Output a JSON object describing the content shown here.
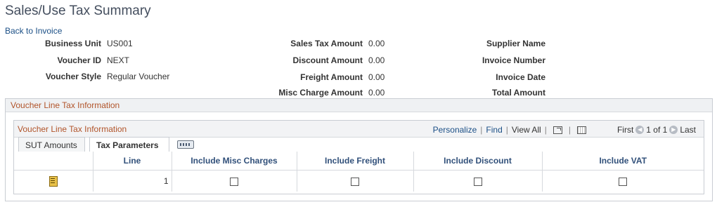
{
  "page_title": "Sales/Use Tax Summary",
  "back_link": "Back to Invoice",
  "fields": {
    "business_unit": {
      "label": "Business Unit",
      "value": "US001"
    },
    "voucher_id": {
      "label": "Voucher ID",
      "value": "NEXT"
    },
    "voucher_style": {
      "label": "Voucher Style",
      "value": "Regular Voucher"
    },
    "sales_tax_amount": {
      "label": "Sales Tax Amount",
      "value": "0.00"
    },
    "discount_amount": {
      "label": "Discount Amount",
      "value": "0.00"
    },
    "freight_amount": {
      "label": "Freight Amount",
      "value": "0.00"
    },
    "misc_charge_amount": {
      "label": "Misc Charge Amount",
      "value": "0.00"
    },
    "supplier_name": {
      "label": "Supplier Name",
      "value": ""
    },
    "invoice_number": {
      "label": "Invoice Number",
      "value": ""
    },
    "invoice_date": {
      "label": "Invoice Date",
      "value": ""
    },
    "total_amount": {
      "label": "Total Amount",
      "value": ""
    }
  },
  "section": {
    "title": "Voucher Line Tax Information"
  },
  "grid": {
    "title": "Voucher Line Tax Information",
    "nav": {
      "personalize": "Personalize",
      "find": "Find",
      "view_all": "View All",
      "first": "First",
      "range": "1 of 1",
      "last": "Last"
    },
    "tabs": {
      "sut_amounts": "SUT Amounts",
      "tax_parameters": "Tax Parameters"
    },
    "columns": [
      "Line",
      "Include Misc Charges",
      "Include Freight",
      "Include Discount",
      "Include VAT"
    ],
    "rows": [
      {
        "line": "1",
        "include_misc_charges": false,
        "include_freight": false,
        "include_discount": false,
        "include_vat": false
      }
    ]
  }
}
